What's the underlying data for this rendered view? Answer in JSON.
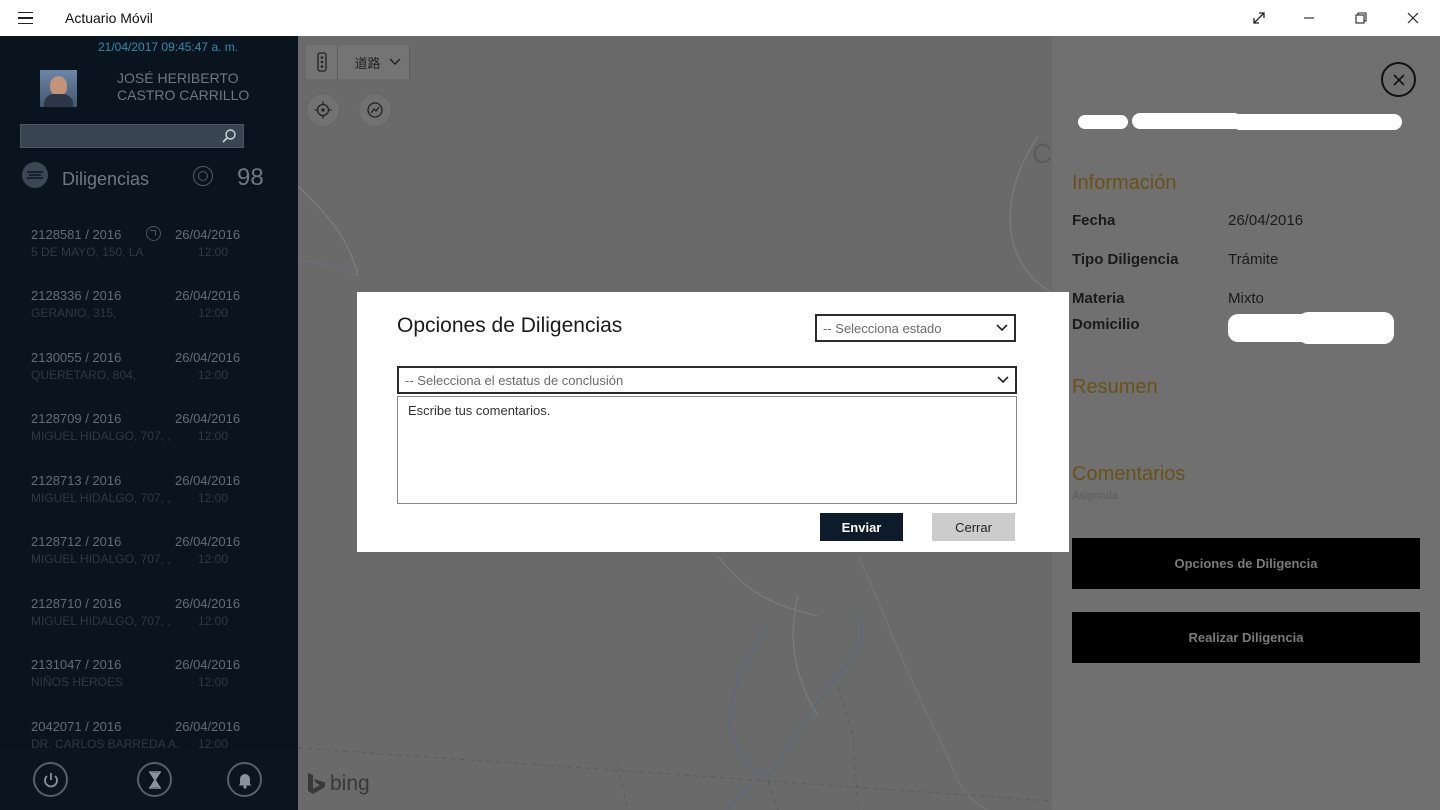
{
  "window": {
    "title": "Actuario Móvil",
    "controls": [
      "fullscreen-icon",
      "minimize-icon",
      "restore-icon",
      "close-icon"
    ]
  },
  "sidebar": {
    "datetime": "21/04/2017 09:45:47 a. m.",
    "user_name_line1": "JOSÉ HERIBERTO",
    "user_name_line2": "CASTRO CARRILLO",
    "search": {
      "value": "",
      "placeholder": ""
    },
    "section_title": "Diligencias",
    "count": "98",
    "items": [
      {
        "id": "2128581 / 2016",
        "date": "26/04/2016",
        "address": "5 DE MAYO, 150, LA",
        "time": "12:00",
        "has_nav_icon": true
      },
      {
        "id": "2128336 / 2016",
        "date": "26/04/2016",
        "address": "GERANIO, 315,",
        "time": "12:00"
      },
      {
        "id": "2130055 / 2016",
        "date": "26/04/2016",
        "address": "QUERETARO, 804,",
        "time": "12:00"
      },
      {
        "id": "2128709 / 2016",
        "date": "26/04/2016",
        "address": "MIGUEL HIDALGO, 707, ,",
        "time": "12:00"
      },
      {
        "id": "2128713 / 2016",
        "date": "26/04/2016",
        "address": "MIGUEL HIDALGO, 707, ,",
        "time": "12:00"
      },
      {
        "id": "2128712 / 2016",
        "date": "26/04/2016",
        "address": "MIGUEL HIDALGO, 707, ,",
        "time": "12:00"
      },
      {
        "id": "2128710 / 2016",
        "date": "26/04/2016",
        "address": "MIGUEL HIDALGO, 707, ,",
        "time": "12:00"
      },
      {
        "id": "2131047 / 2016",
        "date": "26/04/2016",
        "address": "NIÑOS HEROES",
        "time": "12:00"
      },
      {
        "id": "2042071 / 2016",
        "date": "26/04/2016",
        "address": "DR. CARLOS BARREDA A.",
        "time": "12:00"
      }
    ],
    "bottom_icons": [
      "power-icon",
      "hourglass-icon",
      "bell-icon"
    ]
  },
  "map": {
    "style_label": "道路",
    "logo": "bing",
    "partial_label": "C"
  },
  "details": {
    "info_heading": "Información",
    "fields": [
      {
        "label": "Fecha",
        "value": "26/04/2016"
      },
      {
        "label": "Tipo Diligencia",
        "value": "Trámite"
      },
      {
        "label": "Materia",
        "value": "Mixto"
      },
      {
        "label": "Domicilio",
        "value": ""
      }
    ],
    "summary_heading": "Resumen",
    "comments_heading": "Comentarios",
    "comments_sub": "Asignada",
    "options_button": "Opciones de Diligencia",
    "perform_button": "Realizar Diligencia"
  },
  "dialog": {
    "title": "Opciones de Diligencias",
    "state_select": "-- Selecciona estado",
    "conclusion_select": "-- Selecciona el estatus de conclusión",
    "comments_placeholder": "Escribe tus comentarios.",
    "send_label": "Enviar",
    "close_label": "Cerrar"
  }
}
